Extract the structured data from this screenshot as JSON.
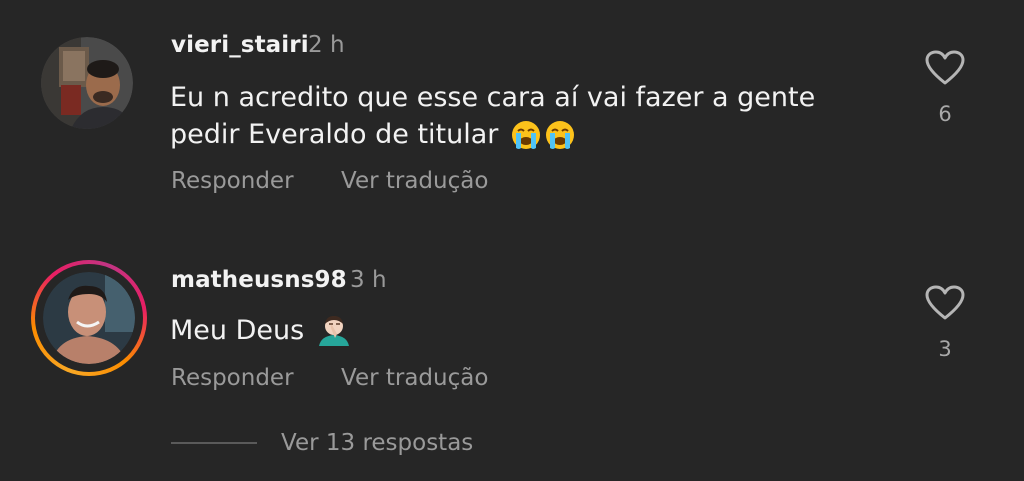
{
  "comments": [
    {
      "username": "vieri_stairi",
      "time": "2 h",
      "text": "Eu n acredito que esse cara aí vai fazer a gente pedir Everaldo de titular",
      "emoji": [
        "loudly-crying-face-emoji",
        "loudly-crying-face-emoji"
      ],
      "reply_label": "Responder",
      "translate_label": "Ver tradução",
      "like_count": "6",
      "story_ring": false
    },
    {
      "username": "matheusns98",
      "time": "3 h",
      "text": "Meu Deus",
      "emoji": [
        "man-facepalming-emoji"
      ],
      "reply_label": "Responder",
      "translate_label": "Ver tradução",
      "like_count": "3",
      "story_ring": true
    }
  ],
  "view_replies_label": "Ver 13 respostas",
  "colors": {
    "background": "#262626",
    "primary_text": "#f2f2f2",
    "secondary_text": "#9a9a9a",
    "story_ring_start": "#f9a825",
    "story_ring_end": "#c13584"
  }
}
